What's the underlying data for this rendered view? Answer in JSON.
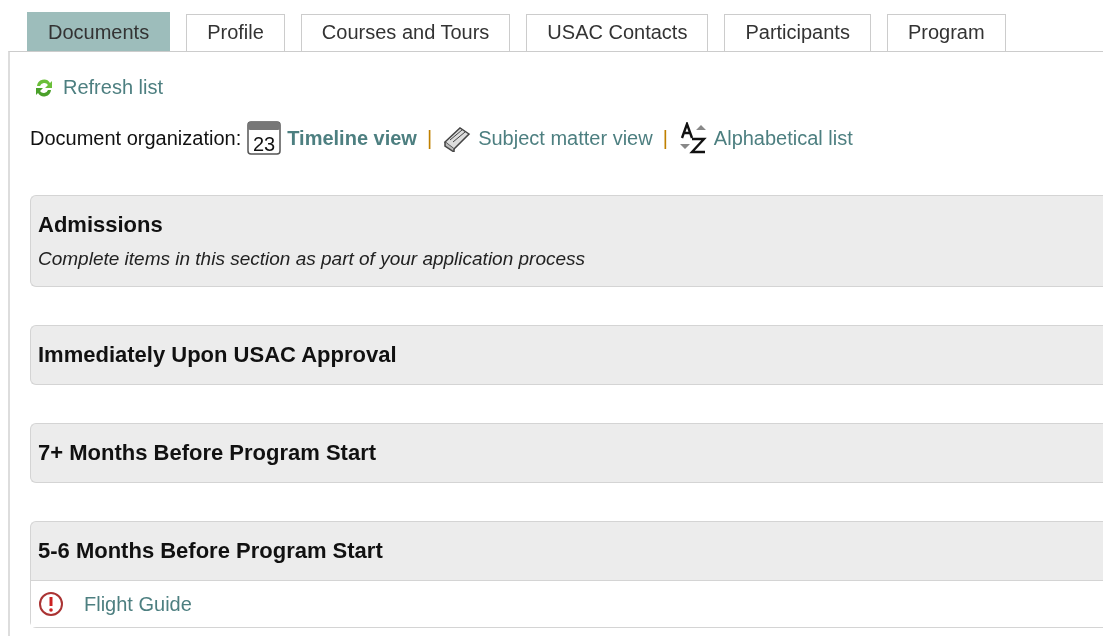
{
  "tabs": [
    {
      "label": "Documents",
      "selected": true
    },
    {
      "label": "Profile",
      "selected": false
    },
    {
      "label": "Courses and Tours",
      "selected": false
    },
    {
      "label": "USAC Contacts",
      "selected": false
    },
    {
      "label": "Participants",
      "selected": false
    },
    {
      "label": "Program",
      "selected": false
    }
  ],
  "refresh": {
    "label": "Refresh list"
  },
  "organization": {
    "label": "Document organization:",
    "views": [
      {
        "kind": "timeline",
        "icon_text": "23",
        "label": "Timeline view",
        "selected": true
      },
      {
        "kind": "subject",
        "separator": "|",
        "label": "Subject matter view",
        "selected": false
      },
      {
        "kind": "alphabetical",
        "separator": "|",
        "label": "Alphabetical list",
        "selected": false
      }
    ]
  },
  "sections": [
    {
      "title": "Admissions",
      "description": "Complete items in this section as part of your application process"
    },
    {
      "title": "Immediately Upon USAC Approval"
    },
    {
      "title": "7+ Months Before Program Start"
    },
    {
      "title": "5-6 Months Before Program Start",
      "items": [
        {
          "label": "Flight Guide"
        }
      ]
    }
  ]
}
